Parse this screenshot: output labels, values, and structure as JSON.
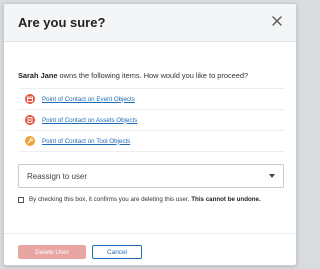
{
  "dialog": {
    "title": "Are you sure?",
    "close_icon": "close-icon"
  },
  "message": {
    "user_name": "Sarah Jane",
    "text": "owns the following items. How would you like to proceed?"
  },
  "items": [
    {
      "label": "Point of Contact on Event Objects",
      "icon": "calendar-icon"
    },
    {
      "label": "Point of Contact on Assets Objects",
      "icon": "document-icon"
    },
    {
      "label": "Point of Contact on Tool Objects",
      "icon": "wrench-icon"
    }
  ],
  "reassign_select": {
    "value": "Reassign to user"
  },
  "confirmation": {
    "text": "By checking this box, it confirms you are deleting this user.",
    "emphasis": "This cannot be undone.",
    "checked": false
  },
  "buttons": {
    "delete_label": "Delete User",
    "cancel_label": "Cancel"
  },
  "colors": {
    "icon_accent": "#e0543e",
    "link": "#1e6bb8",
    "delete_disabled": "#e8a6a3"
  }
}
